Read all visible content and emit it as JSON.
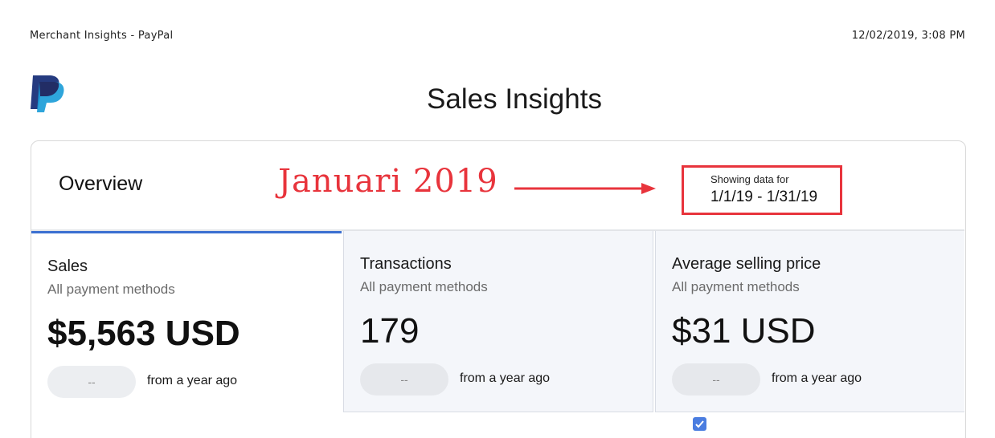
{
  "print_header": {
    "title": "Merchant Insights - PayPal",
    "datetime": "12/02/2019, 3:08 PM"
  },
  "logo": {
    "icon": "paypal-logo"
  },
  "page_title": "Sales Insights",
  "overview": {
    "label": "Overview",
    "annotation": "Januari 2019",
    "date_range": {
      "caption": "Showing data for",
      "value": "1/1/19 - 1/31/19"
    }
  },
  "tiles": [
    {
      "name": "Sales",
      "sub": "All payment methods",
      "value": "$5,563 USD",
      "change": "--",
      "compare": "from a year ago",
      "selected": true
    },
    {
      "name": "Transactions",
      "sub": "All payment methods",
      "value": "179",
      "change": "--",
      "compare": "from a year ago",
      "selected": false
    },
    {
      "name": "Average selling price",
      "sub": "All payment methods",
      "value": "$31 USD",
      "change": "--",
      "compare": "from a year ago",
      "selected": false
    }
  ],
  "colors": {
    "accent": "#3b6fd1",
    "annotation": "#e8343c",
    "paypal_dark": "#253b80",
    "paypal_light": "#179bd7"
  },
  "checkbox": {
    "checked": true,
    "icon": "checkmark-icon"
  }
}
